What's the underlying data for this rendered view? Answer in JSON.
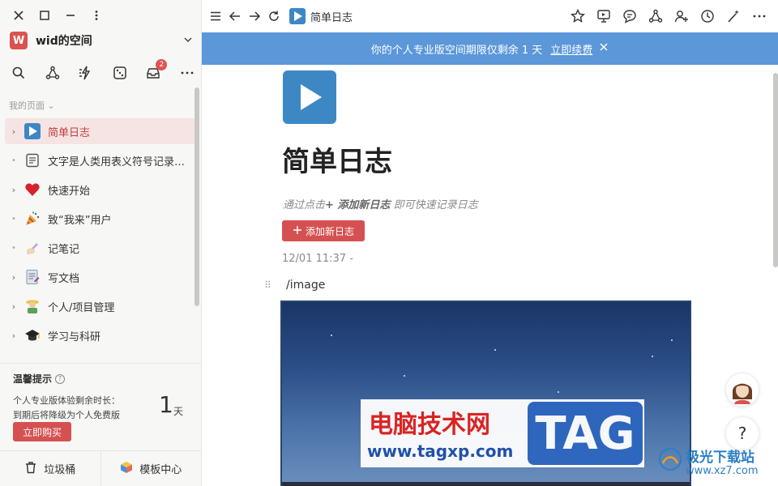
{
  "workspace": {
    "initial": "W",
    "name": "wid的空间",
    "logo_color": "#d9534f"
  },
  "sidebar": {
    "section_label": "我的页面",
    "notification_count": "2",
    "items": [
      {
        "label": "简单日志",
        "icon": "play-icon",
        "active": true,
        "has_children": true
      },
      {
        "label": "文字是人类用表义符号记录表达信息以传之久远的方式和工具",
        "icon": "document-icon",
        "has_children": false
      },
      {
        "label": "快速开始",
        "icon": "heart-icon",
        "has_children": true
      },
      {
        "label": "致“我来”用户",
        "icon": "party-popper-icon",
        "has_children": false
      },
      {
        "label": "记笔记",
        "icon": "writing-hand-icon",
        "has_children": false
      },
      {
        "label": "写文档",
        "icon": "memo-icon",
        "has_children": true
      },
      {
        "label": "个人/项目管理",
        "icon": "farmer-icon",
        "has_children": true
      },
      {
        "label": "学习与科研",
        "icon": "graduation-cap-icon",
        "has_children": true
      }
    ],
    "tip": {
      "title": "温馨提示",
      "line1": "个人专业版体验剩余时长：",
      "line2": "到期后将降级为个人免费版",
      "days": "1",
      "days_unit": "天",
      "buy_label": "立即购买"
    },
    "trash_label": "垃圾桶",
    "templates_label": "模板中心"
  },
  "topbar": {
    "page_name": "简单日志"
  },
  "banner": {
    "text": "你的个人专业版空间期限仅剩余 1 天",
    "link": "立即续费",
    "color": "#5b97d9"
  },
  "page": {
    "title": "简单日志",
    "hint_prefix": "通过点击",
    "hint_action": "+ 添加新日志",
    "hint_suffix": " 即可快速记录日志",
    "add_button": "添加新日志",
    "timestamp": "12/01 11:37 -",
    "command": "/image"
  },
  "watermark": {
    "cn": "电脑技术网",
    "url": "www.tagxp.com",
    "tag": "TAG",
    "site2_name": "极光下载站",
    "site2_url": "www.xz7.com"
  },
  "floating": {
    "help": "?"
  },
  "colors": {
    "accent": "#d55151",
    "active_bg": "#f6e3e3",
    "banner": "#5b97d9"
  }
}
